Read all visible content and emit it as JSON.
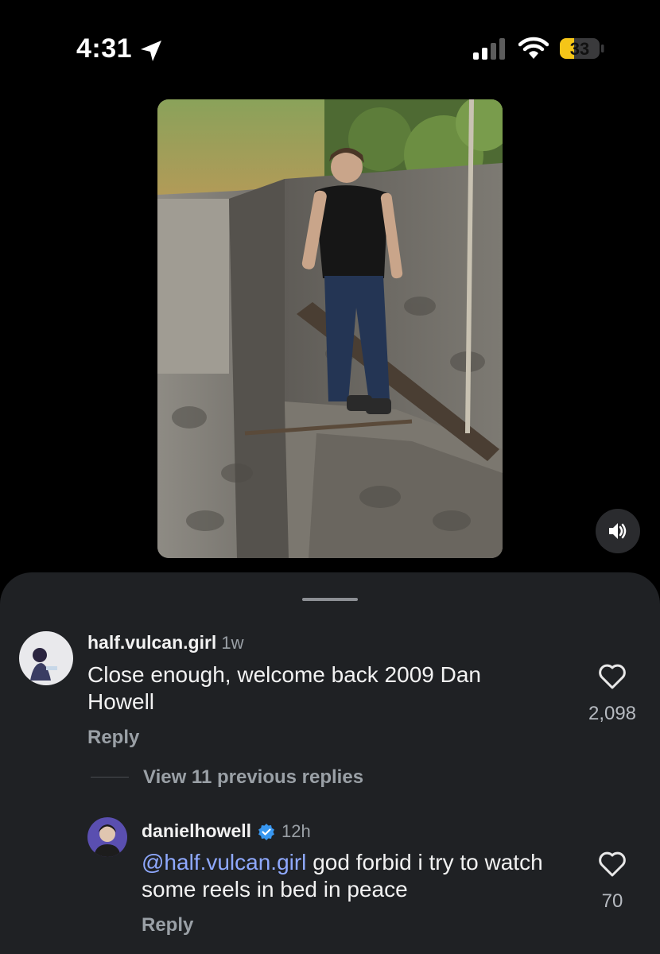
{
  "status_bar": {
    "time": "4:31",
    "battery_level": "33",
    "icons": [
      "location-arrow-icon",
      "cellular-signal-icon",
      "wifi-icon",
      "battery-icon"
    ]
  },
  "video": {
    "sound_icon": "speaker-icon"
  },
  "comments": [
    {
      "username": "half.vulcan.girl",
      "time": "1w",
      "text": "Close enough, welcome back 2009 Dan Howell",
      "reply_label": "Reply",
      "likes": "2,098"
    }
  ],
  "view_replies_label": "View 11 previous replies",
  "reply_comment": {
    "username": "danielhowell",
    "verified": true,
    "time": "12h",
    "mention": "@half.vulcan.girl",
    "text": "god forbid i try to watch some reels in bed in peace",
    "reply_label": "Reply",
    "likes": "70"
  },
  "colors": {
    "background": "#000000",
    "sheet": "#1f2124",
    "mention": "#8fa9ff",
    "verified": "#3897f0",
    "battery_low": "#f5c518"
  }
}
